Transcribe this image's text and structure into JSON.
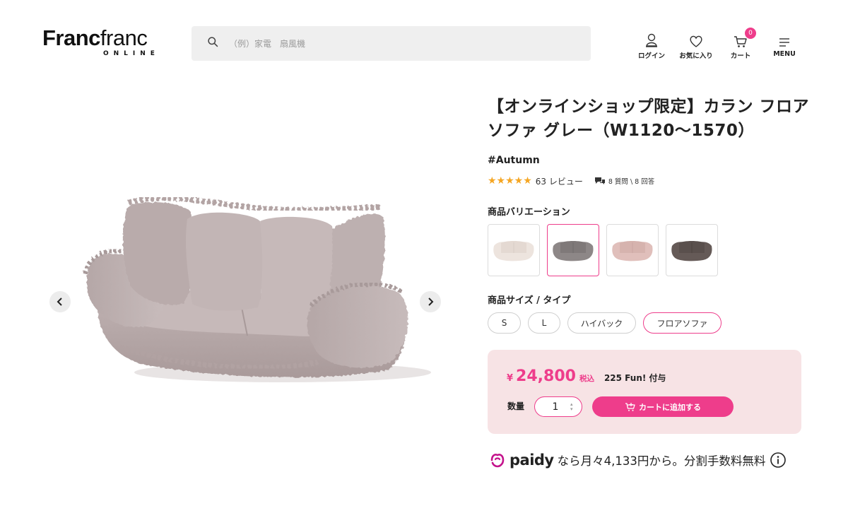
{
  "header": {
    "logo_bold": "Franc",
    "logo_light": "franc",
    "logo_sub": "ONLINE",
    "search_placeholder": "（例）家電　扇風機",
    "nav": {
      "login": "ログイン",
      "favorites": "お気に入り",
      "cart": "カート",
      "cart_count": "0",
      "menu": "MENU"
    }
  },
  "product": {
    "title": "【オンラインショップ限定】カラン フロアソファ グレー（W1120〜1570）",
    "tag": "#Autumn",
    "rating_stars": "★★★★★",
    "review_count": "63 レビュー",
    "qa": "8 質問 \\ 8 回答"
  },
  "variations": {
    "label": "商品バリエーション",
    "items": [
      {
        "name": "ivory",
        "color": "#ede4de",
        "shade": "#d9cdc5"
      },
      {
        "name": "gray",
        "color": "#8d8787",
        "shade": "#6f6a6a",
        "selected": true
      },
      {
        "name": "pink",
        "color": "#e0bfbb",
        "shade": "#c9a5a1"
      },
      {
        "name": "brown",
        "color": "#655a57",
        "shade": "#4c4340"
      }
    ]
  },
  "sizes": {
    "label": "商品サイズ / タイプ",
    "options": [
      "S",
      "L",
      "ハイバック",
      "フロアソファ"
    ],
    "selected": "フロアソファ"
  },
  "purchase": {
    "yen": "¥",
    "price": "24,800",
    "tax": "税込",
    "fun": "225 Fun! 付与",
    "qty_label": "数量",
    "qty_value": "1",
    "add_to_cart": "カートに追加する"
  },
  "paidy": {
    "brand": "paidy",
    "text": "なら月々4,133円から。分割手数料無料"
  },
  "colors": {
    "accent": "#ee3d8b",
    "price_box_bg": "#f7e3e5",
    "star": "#f5a623",
    "sofa_main": "#bcaeae",
    "sofa_shade": "#a39494",
    "sofa_light": "#cbbebe"
  }
}
